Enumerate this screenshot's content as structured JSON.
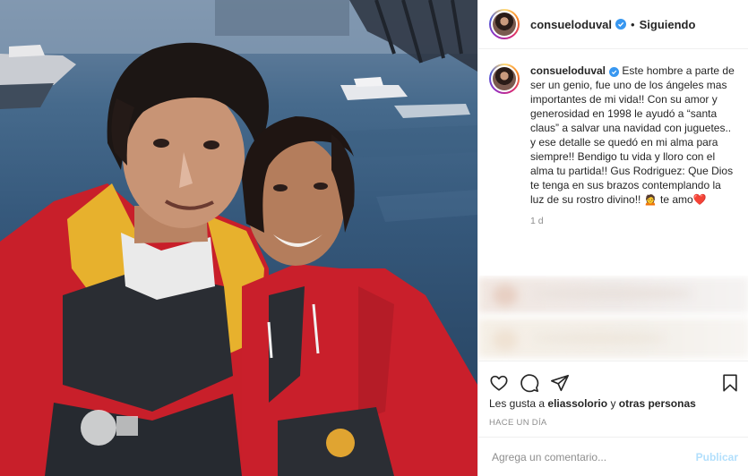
{
  "post": {
    "username": "consueloduval",
    "follow_status": "Siguiendo",
    "caption_username": "consueloduval",
    "caption_text": "Este hombre a parte de ser un genio, fue uno de los ángeles mas importantes de mi vida!! Con su amor y generosidad en 1998 le ayudó a “santa claus” a salvar una navidad con juguetes.. y ese detalle se quedó en mi alma para siempre!! Bendigo tu vida y lloro con el alma tu partida!! Gus Rodriguez: Que Dios te tenga en sus brazos contemplando la luz de su rostro divino!! 🙍 te amo❤️",
    "caption_age": "1 d",
    "likes_prefix": "Les gusta a",
    "likes_user": "eliassolorio",
    "likes_and": "y",
    "likes_others": "otras personas",
    "time_ago": "HACE UN DÍA"
  },
  "comment": {
    "placeholder": "Agrega un comentario...",
    "post_label": "Publicar"
  },
  "icons": {
    "like": "heart-icon",
    "comment": "comment-icon",
    "share": "share-icon",
    "save": "bookmark-icon",
    "verified": "verified-badge-icon"
  },
  "colors": {
    "verified": "#3897f0",
    "post_button": "#b2dffc",
    "secondary_text": "#8e8e8e"
  }
}
